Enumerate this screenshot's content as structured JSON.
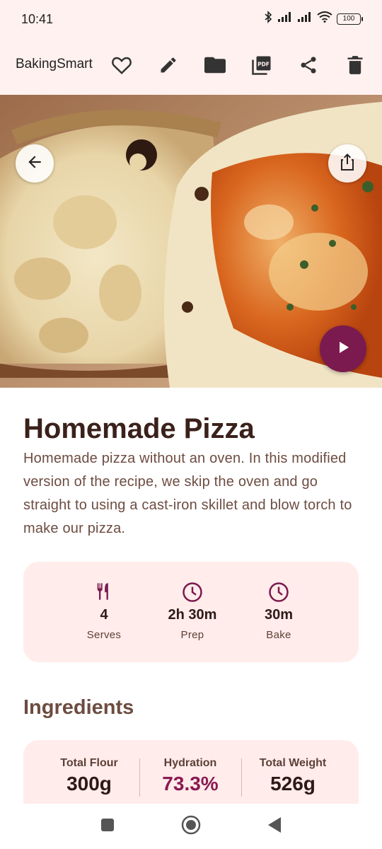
{
  "status": {
    "time": "10:41",
    "battery": "100"
  },
  "app": {
    "title": "BakingSmart",
    "actions": [
      "favorite-icon",
      "edit-icon",
      "folder-icon",
      "pdf-icon",
      "share-icon",
      "delete-icon"
    ]
  },
  "recipe": {
    "title": "Homemade Pizza",
    "description": "Homemade pizza without an oven. In this modified version of the recipe, we skip the oven and go straight to using a cast-iron skillet and blow torch to make our pizza."
  },
  "stats": [
    {
      "icon": "utensils-icon",
      "value": "4",
      "label": "Serves"
    },
    {
      "icon": "clock-icon",
      "value": "2h 30m",
      "label": "Prep"
    },
    {
      "icon": "clock-icon",
      "value": "30m",
      "label": "Bake"
    }
  ],
  "ingredients": {
    "title": "Ingredients",
    "totals": [
      {
        "label": "Total Flour",
        "value": "300g"
      },
      {
        "label": "Hydration",
        "value": "73.3%"
      },
      {
        "label": "Total Weight",
        "value": "526g"
      }
    ]
  },
  "colors": {
    "accent": "#7b1a4e",
    "surface": "#fff1ef",
    "card": "#ffeceb",
    "title": "#3b211b"
  }
}
